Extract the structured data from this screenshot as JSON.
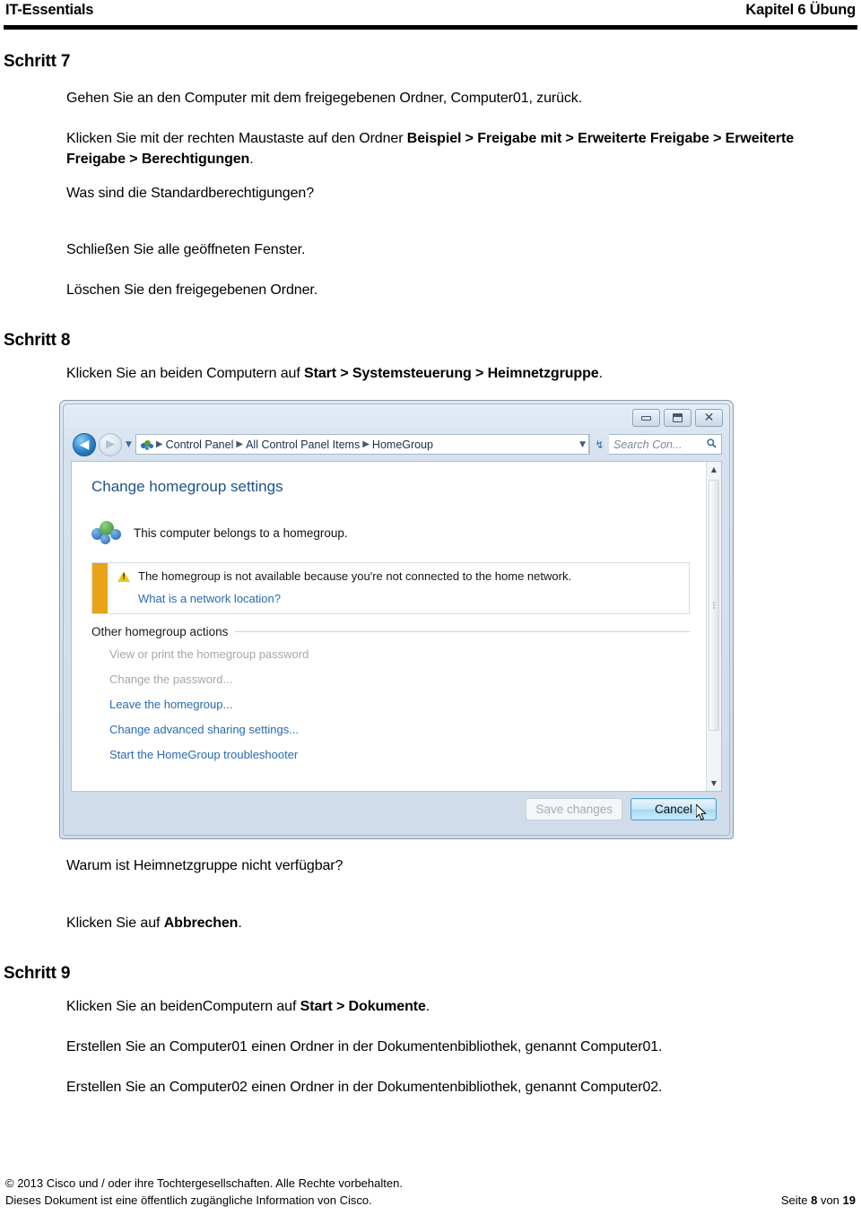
{
  "header": {
    "left": "IT-Essentials",
    "right": "Kapitel 6 Übung"
  },
  "steps": {
    "step7": {
      "title": "Schritt 7",
      "p1": "Gehen Sie an den Computer mit dem freigegebenen Ordner, Computer01, zurück.",
      "p2_prefix": "Klicken Sie mit der rechten Maustaste auf den Ordner ",
      "p2_bold": "Beispiel > Freigabe mit > Erweiterte Freigabe > Erweiterte Freigabe > Berechtigungen",
      "p2_suffix": ".",
      "p3": "Was sind die Standardberechtigungen?",
      "p4": "Schließen Sie alle geöffneten Fenster.",
      "p5": "Löschen Sie den freigegebenen Ordner."
    },
    "step8": {
      "title": "Schritt 8",
      "p1_prefix": "Klicken Sie an beiden Computern auf ",
      "p1_bold": "Start > Systemsteuerung > Heimnetzgruppe",
      "p1_suffix": ".",
      "p2": "Warum ist Heimnetzgruppe nicht verfügbar?",
      "p3_prefix": "Klicken Sie auf ",
      "p3_bold": "Abbrechen",
      "p3_suffix": "."
    },
    "step9": {
      "title": "Schritt 9",
      "p1_prefix": "Klicken Sie an beidenComputern auf ",
      "p1_bold": "Start > Dokumente",
      "p1_suffix": ".",
      "p2": "Erstellen Sie an Computer01 einen Ordner in der Dokumentenbibliothek, genannt Computer01.",
      "p3": "Erstellen Sie an Computer02 einen Ordner in der Dokumentenbibliothek, genannt Computer02."
    }
  },
  "screenshot": {
    "window_buttons": {
      "minimize": "minimize-icon",
      "restore": "restore-icon",
      "close": "✕"
    },
    "nav": {
      "back": "◀",
      "forward": "▶",
      "recent_caret": "▼"
    },
    "breadcrumb": {
      "icon": "homegroup-icon",
      "items": [
        "Control Panel",
        "All Control Panel Items",
        "HomeGroup"
      ],
      "separator": "▶",
      "dropdown_caret": "▼"
    },
    "refresh": "↯",
    "search": {
      "placeholder": "Search Con...",
      "icon": "🔍"
    },
    "pane": {
      "title": "Change homegroup settings",
      "belongs_text": "This computer belongs to a homegroup.",
      "warning": {
        "message": "The homegroup is not available because you're not connected to the home network.",
        "link": "What is a network location?",
        "bar_color": "#e8a317"
      },
      "section_heading": "Other homegroup actions",
      "actions": [
        {
          "label": "View or print the homegroup password",
          "disabled": true
        },
        {
          "label": "Change the password...",
          "disabled": true
        },
        {
          "label": "Leave the homegroup...",
          "disabled": false
        },
        {
          "label": "Change advanced sharing settings...",
          "disabled": false
        },
        {
          "label": "Start the HomeGroup troubleshooter",
          "disabled": false
        }
      ]
    },
    "scrollbar": {
      "up_arrow": "▲",
      "down_arrow": "▼"
    },
    "buttons": {
      "save": "Save changes",
      "cancel": "Cancel"
    }
  },
  "footer": {
    "line1": "© 2013 Cisco und / oder ihre Tochtergesellschaften. Alle Rechte vorbehalten.",
    "line2": "Dieses Dokument ist eine öffentlich zugängliche Information von Cisco.",
    "page_prefix": "Seite ",
    "page_number": "8",
    "page_middle": " von ",
    "page_total": "19"
  }
}
